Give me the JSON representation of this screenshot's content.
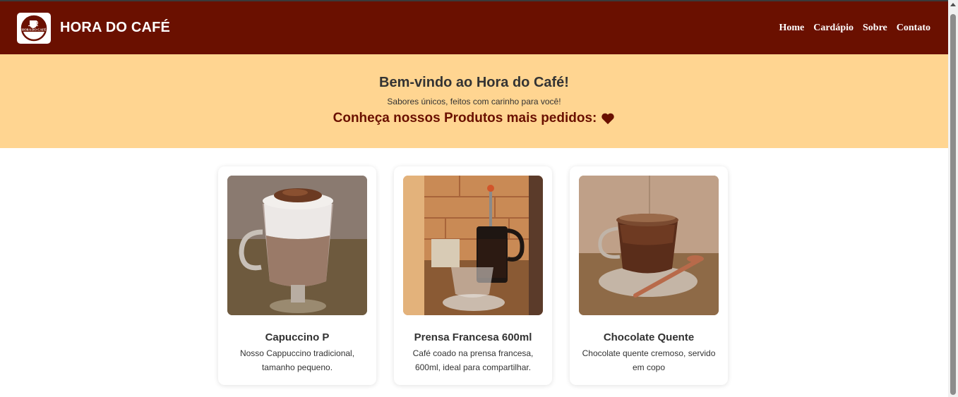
{
  "header": {
    "brand": "HORA DO CAFÉ",
    "logo_text": "HORA DO CAFÉ",
    "nav": [
      "Home",
      "Cardápio",
      "Sobre",
      "Contato"
    ]
  },
  "hero": {
    "title": "Bem-vindo ao Hora do Café!",
    "subtitle": "Sabores únicos, feitos com carinho para você!",
    "highlight": "Conheça nossos Produtos mais pedidos:",
    "highlight_icon": "heart-icon"
  },
  "products": [
    {
      "name": "Capuccino P",
      "description": "Nosso Cappuccino tradicional, tamanho pequeno."
    },
    {
      "name": "Prensa Francesa 600ml",
      "description": "Café coado na prensa francesa, 600ml, ideal para compartilhar."
    },
    {
      "name": "Chocolate Quente",
      "description": "Chocolate quente cremoso, servido em copo"
    }
  ],
  "colors": {
    "navbar": "#6a1000",
    "hero_bg": "#ffd591",
    "accent": "#6a1000"
  }
}
